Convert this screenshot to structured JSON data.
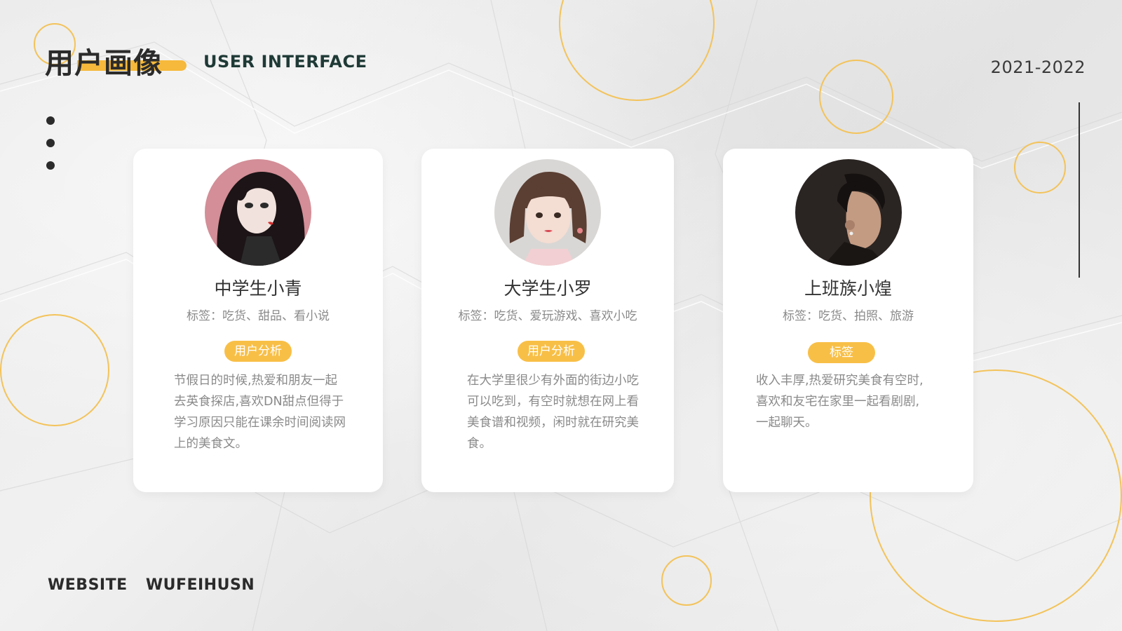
{
  "header": {
    "title": "用户画像",
    "subtitle": "USER INTERFACE",
    "year": "2021-2022"
  },
  "footer": {
    "website_label": "WEBSITE",
    "website_name": "WUFEIHUSN"
  },
  "colors": {
    "accent": "#f8bf47",
    "ring": "#f3c35a",
    "text_dark": "#2b2b2b",
    "text_muted": "#8a8a8a",
    "card_bg": "#ffffff"
  },
  "cards": [
    {
      "name": "中学生小青",
      "tags": "标签：吃货、甜品、看小说",
      "badge": "用户分析",
      "description_lines": [
        "节假日的时候,热爱和朋友一起",
        "去英食探店,喜欢DN甜点但得于",
        "学习原因只能在课余时间阅读网",
        "上的美食文。"
      ],
      "avatar_icon": "illustrated-girl-avatar"
    },
    {
      "name": "大学生小罗",
      "tags": "标签：吃货、爱玩游戏、喜欢小吃",
      "badge": "用户分析",
      "description_lines": [
        "在大学里很少有外面的街边小吃",
        "可以吃到，有空时就想在网上看",
        "美食谱和视频，闲时就在研究美",
        "食。"
      ],
      "avatar_icon": "young-woman-photo-avatar"
    },
    {
      "name": "上班族小煌",
      "tags": "标签：吃货、拍照、旅游",
      "badge": "标签",
      "description_lines": [
        "收入丰厚,热爱研究美食有空时,",
        "喜欢和友宅在家里一起看剧剧,",
        "一起聊天。"
      ],
      "avatar_icon": "young-man-photo-avatar"
    }
  ]
}
